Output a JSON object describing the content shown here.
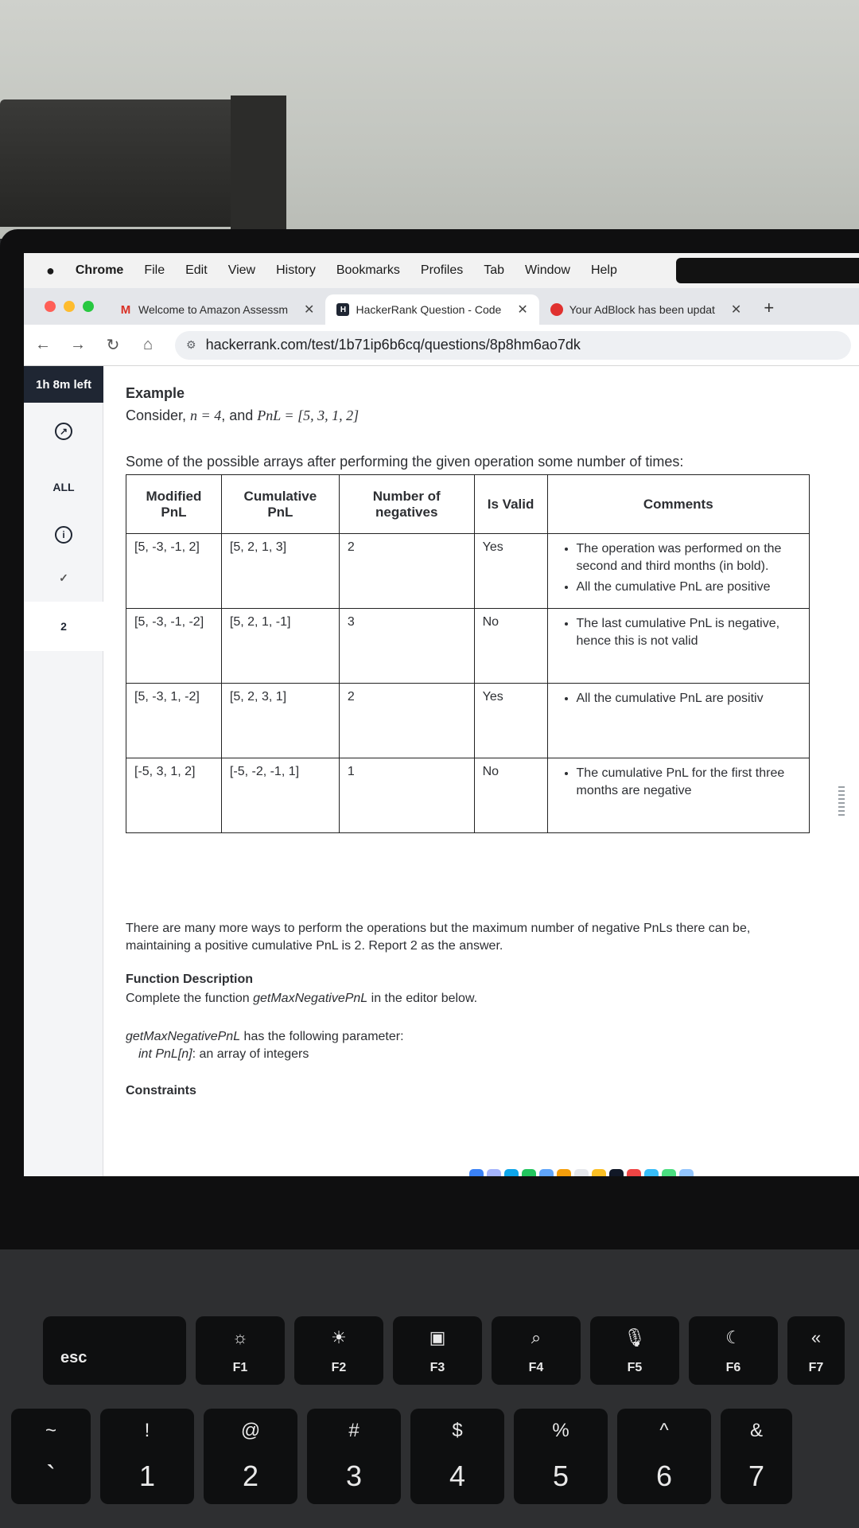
{
  "menubar": {
    "app": "Chrome",
    "items": [
      "File",
      "Edit",
      "View",
      "History",
      "Bookmarks",
      "Profiles",
      "Tab",
      "Window",
      "Help"
    ]
  },
  "tabs": [
    {
      "label": "Welcome to Amazon Assessm",
      "icon": "gmail-icon",
      "color": "#d93025"
    },
    {
      "label": "HackerRank Question - Code",
      "icon": "hackerrank-icon",
      "color": "#1f2633"
    },
    {
      "label": "Your AdBlock has been updat",
      "icon": "adblock-icon",
      "color": "#e0312f"
    }
  ],
  "address": {
    "url": "hackerrank.com/test/1b71ip6b6cq/questions/8p8hm6ao7dk"
  },
  "sidebar": {
    "timer": "1h 8m left",
    "all_label": "ALL",
    "question_number": "2"
  },
  "content": {
    "example_heading": "Example",
    "consider_prefix": "Consider, ",
    "consider_n": "n = 4",
    "consider_mid": ", and ",
    "consider_pnl": "PnL = [5, 3, 1, 2]",
    "table_intro": "Some of the possible arrays after performing the given operation some number of times:",
    "table": {
      "headers": [
        "Modified PnL",
        "Cumulative PnL",
        "Number of negatives",
        "Is Valid",
        "Comments"
      ],
      "rows": [
        {
          "modified": "[5, -3, -1, 2]",
          "cumulative": "[5, 2, 1, 3]",
          "negatives": "2",
          "valid": "Yes",
          "comments": [
            "The operation was performed on the second and third months (in bold).",
            "All the cumulative PnL are positive"
          ]
        },
        {
          "modified": "[5, -3, -1, -2]",
          "cumulative": "[5, 2, 1, -1]",
          "negatives": "3",
          "valid": "No",
          "comments": [
            "The last cumulative PnL is negative, hence this is not valid"
          ]
        },
        {
          "modified": "[5, -3, 1, -2]",
          "cumulative": "[5, 2, 3, 1]",
          "negatives": "2",
          "valid": "Yes",
          "comments": [
            "All the cumulative PnL are positiv"
          ]
        },
        {
          "modified": "[-5, 3, 1, 2]",
          "cumulative": "[-5, -2, -1, 1]",
          "negatives": "1",
          "valid": "No",
          "comments": [
            "The cumulative PnL for the first three months are negative"
          ]
        }
      ]
    },
    "answer_text": "There are many more ways to perform the operations but the maximum number of negative PnLs there can be, maintaining a positive cumulative PnL is 2. Report 2 as the answer.",
    "function_heading": "Function Description",
    "function_text_prefix": "Complete the function ",
    "function_name": "getMaxNegativePnL",
    "function_text_suffix": " in the editor below.",
    "param_intro_name": "getMaxNegativePnL",
    "param_intro_suffix": " has the following parameter:",
    "param_name": "int PnL[n]",
    "param_desc": ":  an array of integers",
    "constraints_heading": "Constraints"
  },
  "keyboard": {
    "fkeys": [
      {
        "label": "F1",
        "sym": "☼"
      },
      {
        "label": "F2",
        "sym": "☀"
      },
      {
        "label": "F3",
        "sym": "▣"
      },
      {
        "label": "F4",
        "sym": "⌕"
      },
      {
        "label": "F5",
        "sym": "🎙"
      },
      {
        "label": "F6",
        "sym": "☾"
      },
      {
        "label": "F7",
        "sym": "«"
      }
    ],
    "esc": "esc",
    "number_keys": [
      {
        "top": "~",
        "bottom": "`"
      },
      {
        "top": "!",
        "bottom": "1"
      },
      {
        "top": "@",
        "bottom": "2"
      },
      {
        "top": "#",
        "bottom": "3"
      },
      {
        "top": "$",
        "bottom": "4"
      },
      {
        "top": "%",
        "bottom": "5"
      },
      {
        "top": "^",
        "bottom": "6"
      },
      {
        "top": "&",
        "bottom": "7"
      }
    ]
  }
}
